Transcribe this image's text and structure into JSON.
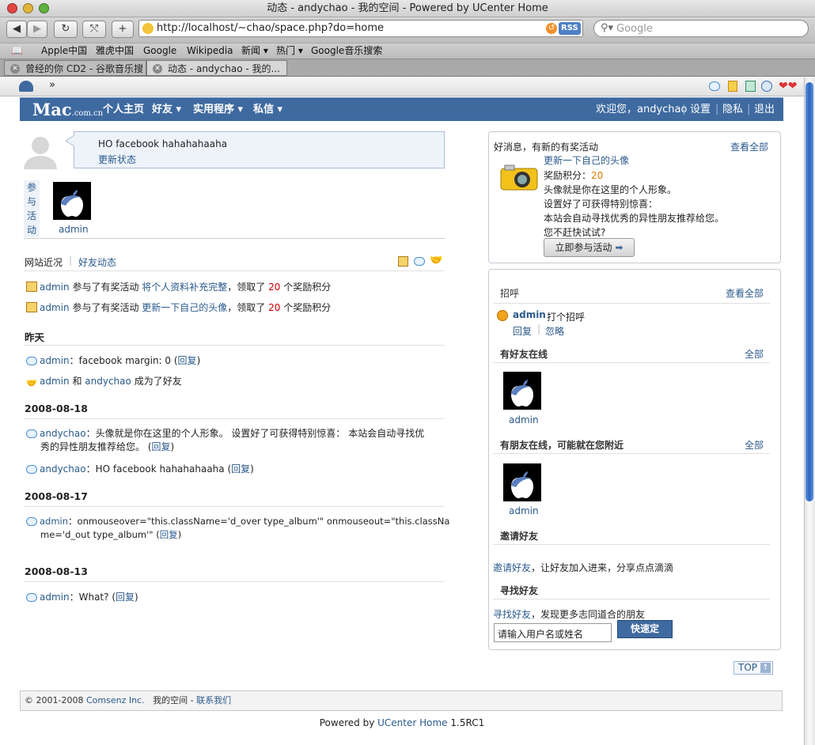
{
  "browser": {
    "title": "动态 - andychao - 我的空间 - Powered by UCenter Home",
    "url": "http://localhost/~chao/space.php?do=home",
    "rss": "RSS",
    "search_placeholder": "Google",
    "bookmarks": [
      "Apple中国",
      "雅虎中国",
      "Google",
      "Wikipedia",
      "新闻 ▾",
      "热门 ▾",
      "Google音乐搜索"
    ],
    "tabs": [
      "曾经的你 CD2 - 谷歌音乐搜索",
      "动态 - andychao - 我的..."
    ],
    "ext_more": "»"
  },
  "header": {
    "logo": "Mac",
    "logo_suffix": ".com.cn",
    "nav": [
      "个人主页",
      "好友 ▾",
      "实用程序 ▾",
      "私信 ▾"
    ],
    "welcome": "欢迎您，andychao",
    "right_links": [
      "设置",
      "隐私",
      "退出"
    ]
  },
  "status": {
    "text": "HO facebook hahahahaaha",
    "update_link": "更新状态"
  },
  "activity": {
    "label_chars": [
      "参",
      "与",
      "活",
      "动"
    ],
    "user": "admin"
  },
  "tabs": {
    "site": "网站近况",
    "friends": "好友动态"
  },
  "feed": {
    "recent": [
      {
        "user": "admin",
        "verb": "参与了有奖活动",
        "task": "将个人资料补充完整",
        "mid": "，领取了",
        "points": "20",
        "tail": "个奖励积分"
      },
      {
        "user": "admin",
        "verb": "参与了有奖活动",
        "task": "更新一下自己的头像",
        "mid": "，领取了",
        "points": "20",
        "tail": "个奖励积分"
      }
    ],
    "yesterday_label": "昨天",
    "yesterday_1": {
      "user": "admin",
      "text": "：facebook  margin: 0 (",
      "reply": "回复",
      "close": ")"
    },
    "yesterday_2": {
      "user": "admin",
      "and": "和",
      "user2": "andychao",
      "text": "成为了好友"
    },
    "d1": "2008-08-18",
    "d1_1": {
      "user": "andychao",
      "text1": "：头像就是你在这里的个人形象。 设置好了可获得特别惊喜： 本站会自动寻找优",
      "text2": "秀的异性朋友推荐给您。 (",
      "reply": "回复",
      "close": ")"
    },
    "d1_2": {
      "user": "andychao",
      "text": "：HO facebook hahahahaaha (",
      "reply": "回复",
      "close": ")"
    },
    "d2": "2008-08-17",
    "d2_1": {
      "user": "admin",
      "text1": "：onmouseover=\"this.className='d_over type_album'\" onmouseout=\"this.classNa",
      "text2": "me='d_out type_album'\" (",
      "reply": "回复",
      "close": ")"
    },
    "d3": "2008-08-13",
    "d3_1": {
      "user": "admin",
      "text": "：What? (",
      "reply": "回复",
      "close": ")"
    }
  },
  "task_box": {
    "title": "好消息，有新的有奖活动",
    "view_all": "查看全部",
    "task_title": "更新一下自己的头像",
    "reward_label": "奖励积分：",
    "reward_value": "20",
    "lines": [
      "头像就是你在这里的个人形象。",
      "设置好了可获得特别惊喜：",
      "本站会自动寻找优秀的异性朋友推荐给您。",
      "您不赶快试试?"
    ],
    "button": "立即参与活动"
  },
  "side": {
    "greet_title": "招呼",
    "greet_all": "查看全部",
    "greet_user": "admin",
    "greet_text": "打个招呼",
    "greet_reply": "回复",
    "greet_ignore": "忽略",
    "online_title": "有好友在线",
    "online_all": "全部",
    "online_user": "admin",
    "near_title": "有朋友在线，可能就在您附近",
    "near_all": "全部",
    "near_user": "admin",
    "invite_title": "邀请好友",
    "invite_link": "邀请好友",
    "invite_text": "，让好友加入进来，分享点点滴滴",
    "find_title": "寻找好友",
    "find_link": "寻找好友",
    "find_text": "，发现更多志同道合的朋友",
    "find_placeholder": "请输入用户名或姓名",
    "find_button": "快速定"
  },
  "top_button": "TOP",
  "footer": {
    "copyright": "© 2001-2008",
    "company": "Comsenz Inc.",
    "space": "我的空间",
    "sep": "-",
    "contact": "联系我们"
  },
  "powered": {
    "prefix": "Powered by",
    "product": "UCenter Home",
    "version": "1.5RC1"
  }
}
